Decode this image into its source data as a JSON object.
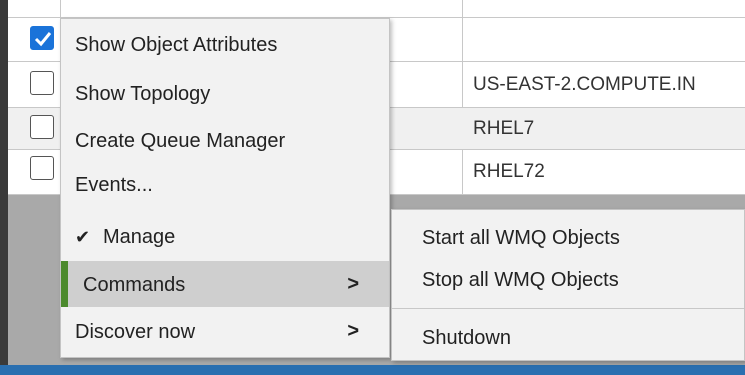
{
  "table": {
    "rows": [
      {
        "checked": true,
        "host": ""
      },
      {
        "checked": false,
        "host": "US-EAST-2.COMPUTE.IN"
      },
      {
        "checked": false,
        "host": "RHEL7"
      },
      {
        "checked": false,
        "host": "RHEL72"
      }
    ]
  },
  "context_menu": {
    "items": [
      {
        "label": "Show Object Attributes"
      },
      {
        "label": "Show Topology"
      },
      {
        "label": "Create Queue Manager"
      },
      {
        "label": "Events..."
      },
      {
        "label": "Manage",
        "check": "✔"
      },
      {
        "label": "Commands",
        "arrow": ">"
      },
      {
        "label": "Discover now",
        "arrow": ">"
      }
    ]
  },
  "submenu": {
    "items": [
      {
        "label": "Start all WMQ Objects"
      },
      {
        "label": "Stop all WMQ Objects"
      },
      {
        "label": "Shutdown"
      }
    ]
  },
  "colors": {
    "accent": "#4c8a2d",
    "checkbox_blue": "#1a73d9",
    "highlight": "#cfcfcf"
  }
}
